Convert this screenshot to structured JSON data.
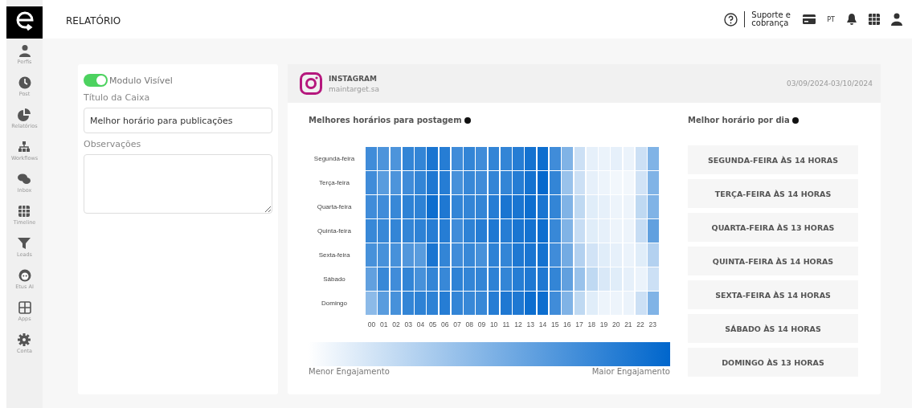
{
  "header": {
    "title": "RELATÓRIO",
    "support": "Suporte e cobrança",
    "language": "PT"
  },
  "sidebar": {
    "items": [
      {
        "label": "Perfis"
      },
      {
        "label": "Post"
      },
      {
        "label": "Relatórios"
      },
      {
        "label": "Workflows"
      },
      {
        "label": "Inbox"
      },
      {
        "label": "Timeline"
      },
      {
        "label": "Leads"
      },
      {
        "label": "Etus AI"
      },
      {
        "label": "Apps"
      },
      {
        "label": "Conta"
      }
    ]
  },
  "settings": {
    "toggle": {
      "label": "Modulo Visível",
      "on": true
    },
    "title_label": "Título da Caixa",
    "title_value": "Melhor horário para publicações",
    "notes_label": "Observações"
  },
  "report": {
    "network": "INSTAGRAM",
    "account": "maintarget.sa",
    "period": "03/09/2024-03/10/2024",
    "heatmap": {
      "title": "Melhores horários para postagem",
      "days": [
        "Segunda-feira",
        "Terça-feira",
        "Quarta-feira",
        "Quinta-feira",
        "Sexta-feira",
        "Sábado",
        "Domingo"
      ],
      "hours": [
        "00",
        "01",
        "02",
        "03",
        "04",
        "05",
        "06",
        "07",
        "08",
        "09",
        "10",
        "11",
        "12",
        "13",
        "14",
        "15",
        "16",
        "17",
        "18",
        "19",
        "20",
        "21",
        "22",
        "23"
      ],
      "legend_min": "Menor Engajamento",
      "legend_max": "Maior Engajamento"
    },
    "best": {
      "title": "Melhor horário por dia",
      "items": [
        "SEGUNDA-FEIRA ÀS 14 HORAS",
        "TERÇA-FEIRA ÀS 14 HORAS",
        "QUARTA-FEIRA ÀS 13 HORAS",
        "QUINTA-FEIRA ÀS 14 HORAS",
        "SEXTA-FEIRA ÀS 14 HORAS",
        "SÁBADO ÀS 14 HORAS",
        "DOMINGO ÀS 13 HORAS"
      ]
    }
  }
}
